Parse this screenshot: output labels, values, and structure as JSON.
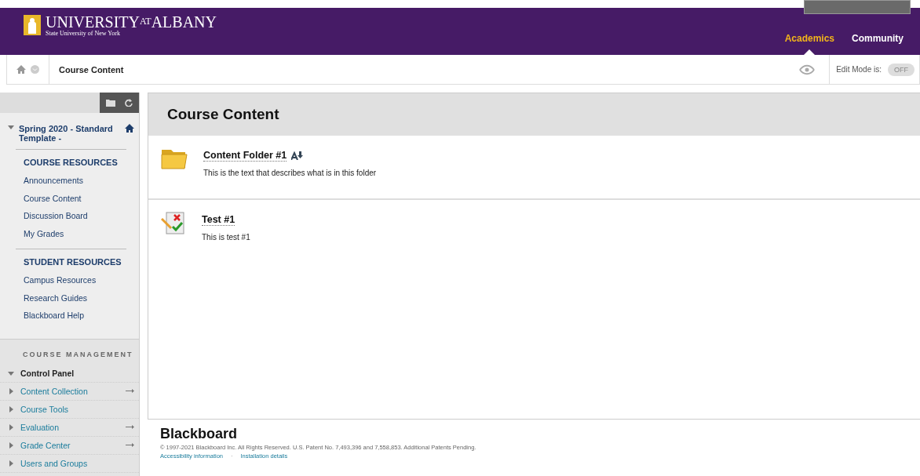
{
  "header": {
    "logo": {
      "parts": [
        "UNIVERSITY",
        "AT",
        "ALBANY"
      ],
      "subtitle": "State University of New York"
    },
    "nav": [
      {
        "label": "Academics",
        "selected": true
      },
      {
        "label": "Community",
        "selected": false
      }
    ]
  },
  "breadcrumb": {
    "label": "Course Content",
    "edit_mode": {
      "label": "Edit Mode is:",
      "state": "OFF",
      "on": false
    }
  },
  "sidebar": {
    "course": {
      "title": "Spring 2020 - Standard Template -",
      "expanded": true
    },
    "sections": [
      {
        "heading": "COURSE RESOURCES",
        "items": [
          "Announcements",
          "Course Content",
          "Discussion Board",
          "My Grades"
        ]
      },
      {
        "heading": "STUDENT RESOURCES",
        "items": [
          "Campus Resources",
          "Research Guides",
          "Blackboard Help"
        ]
      }
    ],
    "management": {
      "heading": "COURSE MANAGEMENT",
      "panel": {
        "label": "Control Panel",
        "expanded": true
      },
      "items": [
        {
          "label": "Content Collection",
          "expanded": false,
          "arrow": true
        },
        {
          "label": "Course Tools",
          "expanded": false,
          "arrow": false
        },
        {
          "label": "Evaluation",
          "expanded": false,
          "arrow": true
        },
        {
          "label": "Grade Center",
          "expanded": false,
          "arrow": true
        },
        {
          "label": "Users and Groups",
          "expanded": false,
          "arrow": false
        }
      ]
    }
  },
  "content": {
    "title": "Course Content",
    "items": [
      {
        "kind": "folder",
        "title": "Content Folder #1",
        "description": "This is the text that describes what is in this folder"
      },
      {
        "kind": "test",
        "title": "Test #1",
        "description": "This is test #1"
      }
    ]
  },
  "footer": {
    "brand": "Blackboard",
    "copyright": "© 1997-2021 Blackboard Inc. All Rights Reserved. U.S. Patent No. 7,493,396 and 7,558,853. Additional Patents Pending.",
    "links": [
      "Accessibility information",
      "Installation details"
    ],
    "separator": "·"
  }
}
